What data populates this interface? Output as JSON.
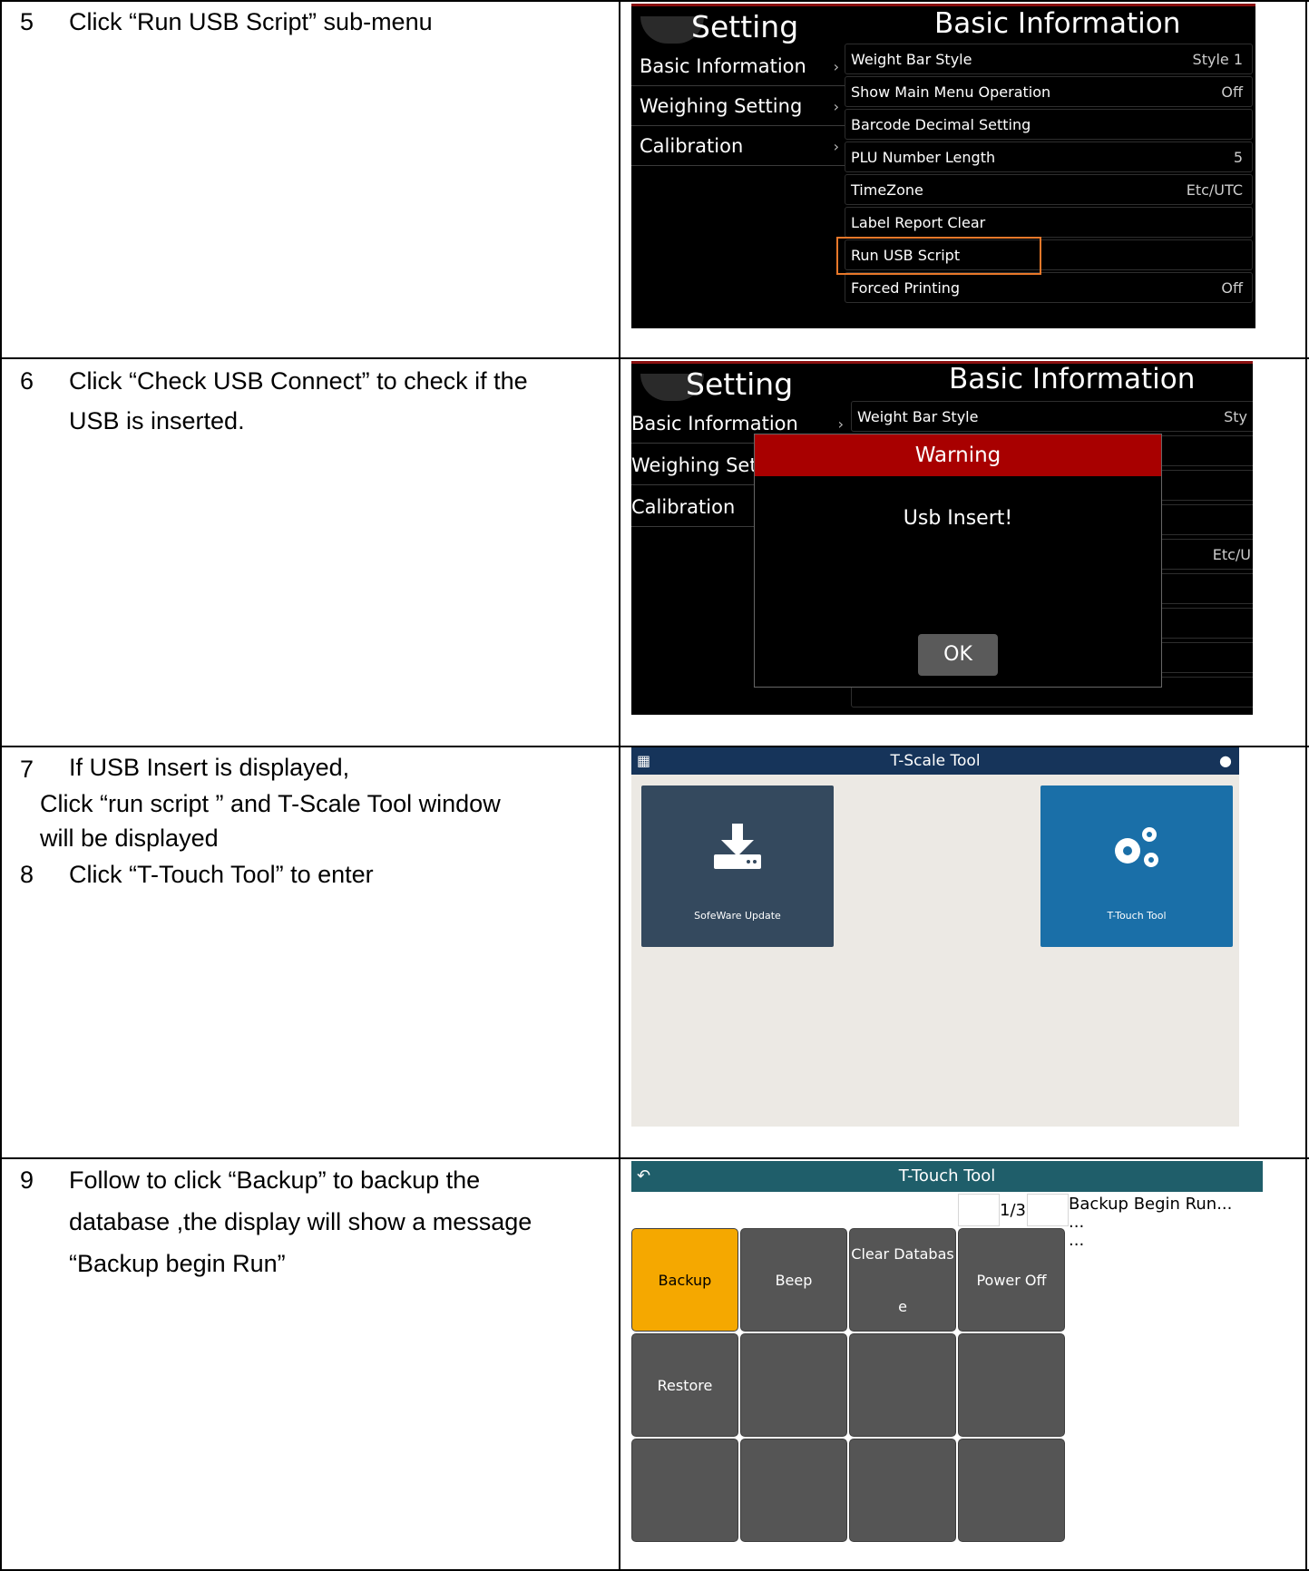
{
  "steps": [
    {
      "num": "5",
      "lines": [
        "Click “Run USB Script” sub-menu"
      ]
    },
    {
      "num": "6",
      "lines": [
        "Click  “Check USB Connect” to check if the",
        "USB is inserted."
      ]
    },
    {
      "num": "7",
      "line1": "If USB Insert is displayed,",
      "line2": "Click  “run script ”  and T-Scale Tool window",
      "line3": "will be displayed"
    },
    {
      "num": "8",
      "line1": "Click “T-Touch Tool” to enter"
    },
    {
      "num": "9",
      "lines": [
        "Follow to click “Backup”  to backup the",
        "database ,the display will show a message",
        "“Backup begin Run”"
      ]
    }
  ],
  "screen1": {
    "setting_title": "Setting",
    "panel_title": "Basic Information",
    "menu": [
      "Basic Information",
      "Weighing Setting",
      "Calibration"
    ],
    "rows": [
      {
        "label": "Weight Bar Style",
        "value": "Style 1"
      },
      {
        "label": "Show Main Menu Operation",
        "value": "Off"
      },
      {
        "label": "Barcode Decimal Setting",
        "value": ""
      },
      {
        "label": "PLU Number Length",
        "value": "5"
      },
      {
        "label": "TimeZone",
        "value": "Etc/UTC"
      },
      {
        "label": "Label Report Clear",
        "value": ""
      },
      {
        "label": "Run USB Script",
        "value": ""
      },
      {
        "label": "Forced Printing",
        "value": "Off"
      }
    ],
    "highlight_color": "#e8782a"
  },
  "screen2": {
    "setting_title": "Setting",
    "panel_title": "Basic Information",
    "menu": [
      "Basic Information",
      "Weighing Set",
      "Calibration"
    ],
    "row_label": "Weight Bar Style",
    "row_value": "Sty",
    "tz_value": "Etc/U",
    "dialog": {
      "title": "Warning",
      "message": "Usb Insert!",
      "ok": "OK"
    },
    "dialog_color": "#a80000"
  },
  "screen3": {
    "title": "T-Scale Tool",
    "header_left_icon": "calendar-icon",
    "header_right_icon": "chat-icon",
    "tiles": [
      {
        "label": "SofeWare Update",
        "icon": "download-icon",
        "color": "#34495e"
      },
      {
        "label": "T-Touch Tool",
        "icon": "gears-icon",
        "color": "#1a6fa8"
      }
    ]
  },
  "screen4": {
    "title": "T-Touch Tool",
    "back_icon": "back-icon",
    "page": "1/3",
    "log": [
      "Backup Begin Run...",
      "...",
      "..."
    ],
    "buttons": [
      "Backup",
      "Beep",
      "Clear Databas",
      "e",
      "Power Off",
      "Restore"
    ],
    "accent": "#f5a800"
  }
}
